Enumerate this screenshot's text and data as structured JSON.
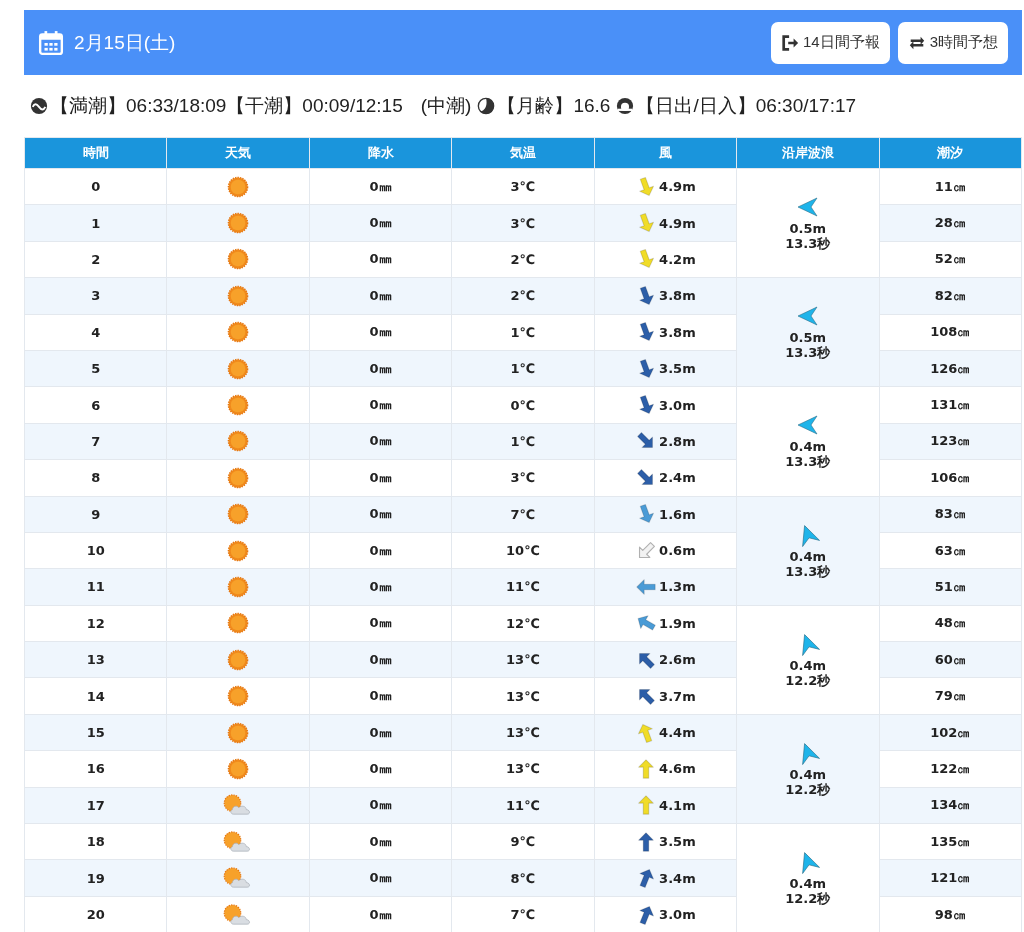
{
  "header": {
    "date": "2月15日(土)",
    "buttons": [
      {
        "label": "14日間予報",
        "kind": "exit"
      },
      {
        "label": "3時間予想",
        "kind": "swap"
      }
    ]
  },
  "info": {
    "tide": "【満潮】06:33/18:09【干潮】00:09/12:15",
    "tide_name": "(中潮)",
    "moon": "【月齢】16.6",
    "sun": "【日出/日入】06:30/17:17"
  },
  "table": {
    "columns": [
      "時間",
      "天気",
      "降水",
      "気温",
      "風",
      "沿岸波浪",
      "潮汐"
    ],
    "rows": [
      {
        "hour": "0",
        "weather": {
          "kind": "sunny"
        },
        "rain": "0㎜",
        "temp": "3℃",
        "wind": {
          "speed": "4.9m",
          "kind": "SSE",
          "color": "#f0dc28"
        },
        "tide": "11㎝"
      },
      {
        "hour": "1",
        "weather": {
          "kind": "sunny"
        },
        "rain": "0㎜",
        "temp": "3℃",
        "wind": {
          "speed": "4.9m",
          "kind": "SSE",
          "color": "#f0dc28"
        },
        "tide": "28㎝"
      },
      {
        "hour": "2",
        "weather": {
          "kind": "sunny"
        },
        "rain": "0㎜",
        "temp": "2℃",
        "wind": {
          "speed": "4.2m",
          "kind": "SSE",
          "color": "#f0dc28"
        },
        "tide": "52㎝"
      },
      {
        "hour": "3",
        "weather": {
          "kind": "sunny"
        },
        "rain": "0㎜",
        "temp": "2℃",
        "wind": {
          "speed": "3.8m",
          "kind": "SSE",
          "color": "#2c5ea8"
        },
        "tide": "82㎝"
      },
      {
        "hour": "4",
        "weather": {
          "kind": "sunny"
        },
        "rain": "0㎜",
        "temp": "1℃",
        "wind": {
          "speed": "3.8m",
          "kind": "SSE",
          "color": "#2c5ea8"
        },
        "tide": "108㎝"
      },
      {
        "hour": "5",
        "weather": {
          "kind": "sunny"
        },
        "rain": "0㎜",
        "temp": "1℃",
        "wind": {
          "speed": "3.5m",
          "kind": "SSE",
          "color": "#2c5ea8"
        },
        "tide": "126㎝"
      },
      {
        "hour": "6",
        "weather": {
          "kind": "sunny"
        },
        "rain": "0㎜",
        "temp": "0℃",
        "wind": {
          "speed": "3.0m",
          "kind": "SSE",
          "color": "#2c5ea8"
        },
        "tide": "131㎝"
      },
      {
        "hour": "7",
        "weather": {
          "kind": "sunny"
        },
        "rain": "0㎜",
        "temp": "1℃",
        "wind": {
          "speed": "2.8m",
          "kind": "SE",
          "color": "#2c5ea8"
        },
        "tide": "123㎝"
      },
      {
        "hour": "8",
        "weather": {
          "kind": "sunny"
        },
        "rain": "0㎜",
        "temp": "3℃",
        "wind": {
          "speed": "2.4m",
          "kind": "SE",
          "color": "#2c5ea8"
        },
        "tide": "106㎝"
      },
      {
        "hour": "9",
        "weather": {
          "kind": "sunny"
        },
        "rain": "0㎜",
        "temp": "7℃",
        "wind": {
          "speed": "1.6m",
          "kind": "SSE",
          "color": "#4a9bd6"
        },
        "tide": "83㎝"
      },
      {
        "hour": "10",
        "weather": {
          "kind": "sunny"
        },
        "rain": "0㎜",
        "temp": "10℃",
        "wind": {
          "speed": "0.6m",
          "kind": "SW",
          "color": "#f2f2f2"
        },
        "tide": "63㎝"
      },
      {
        "hour": "11",
        "weather": {
          "kind": "sunny"
        },
        "rain": "0㎜",
        "temp": "11℃",
        "wind": {
          "speed": "1.3m",
          "kind": "W",
          "color": "#4a9bd6"
        },
        "tide": "51㎝"
      },
      {
        "hour": "12",
        "weather": {
          "kind": "sunny"
        },
        "rain": "0㎜",
        "temp": "12℃",
        "wind": {
          "speed": "1.9m",
          "kind": "WNW",
          "color": "#4a9bd6"
        },
        "tide": "48㎝"
      },
      {
        "hour": "13",
        "weather": {
          "kind": "sunny"
        },
        "rain": "0㎜",
        "temp": "13℃",
        "wind": {
          "speed": "2.6m",
          "kind": "NW",
          "color": "#2c5ea8"
        },
        "tide": "60㎝"
      },
      {
        "hour": "14",
        "weather": {
          "kind": "sunny"
        },
        "rain": "0㎜",
        "temp": "13℃",
        "wind": {
          "speed": "3.7m",
          "kind": "NW",
          "color": "#2c5ea8"
        },
        "tide": "79㎝"
      },
      {
        "hour": "15",
        "weather": {
          "kind": "sunny"
        },
        "rain": "0㎜",
        "temp": "13℃",
        "wind": {
          "speed": "4.4m",
          "kind": "NNW",
          "color": "#f0dc28"
        },
        "tide": "102㎝"
      },
      {
        "hour": "16",
        "weather": {
          "kind": "sunny"
        },
        "rain": "0㎜",
        "temp": "13℃",
        "wind": {
          "speed": "4.6m",
          "kind": "N",
          "color": "#f0dc28"
        },
        "tide": "122㎝"
      },
      {
        "hour": "17",
        "weather": {
          "kind": "sunny_cloudy"
        },
        "rain": "0㎜",
        "temp": "11℃",
        "wind": {
          "speed": "4.1m",
          "kind": "N",
          "color": "#f0dc28"
        },
        "tide": "134㎝"
      },
      {
        "hour": "18",
        "weather": {
          "kind": "sunny_cloudy"
        },
        "rain": "0㎜",
        "temp": "9℃",
        "wind": {
          "speed": "3.5m",
          "kind": "N",
          "color": "#2c5ea8"
        },
        "tide": "135㎝"
      },
      {
        "hour": "19",
        "weather": {
          "kind": "sunny_cloudy"
        },
        "rain": "0㎜",
        "temp": "8℃",
        "wind": {
          "speed": "3.4m",
          "kind": "NNE",
          "color": "#2c5ea8"
        },
        "tide": "121㎝"
      },
      {
        "hour": "20",
        "weather": {
          "kind": "sunny_cloudy"
        },
        "rain": "0㎜",
        "temp": "7℃",
        "wind": {
          "speed": "3.0m",
          "kind": "NNE",
          "color": "#2c5ea8"
        },
        "tide": "98㎝"
      }
    ],
    "waves": [
      {
        "height": "0.5m",
        "period": "13.3秒",
        "kind": "W"
      },
      {
        "height": "0.5m",
        "period": "13.3秒",
        "kind": "W"
      },
      {
        "height": "0.4m",
        "period": "13.3秒",
        "kind": "W"
      },
      {
        "height": "0.4m",
        "period": "13.3秒",
        "kind": "NNW"
      },
      {
        "height": "0.4m",
        "period": "12.2秒",
        "kind": "NNW"
      },
      {
        "height": "0.4m",
        "period": "12.2秒",
        "kind": "NNW"
      },
      {
        "height": "0.4m",
        "period": "12.2秒",
        "kind": "NNW"
      }
    ]
  }
}
